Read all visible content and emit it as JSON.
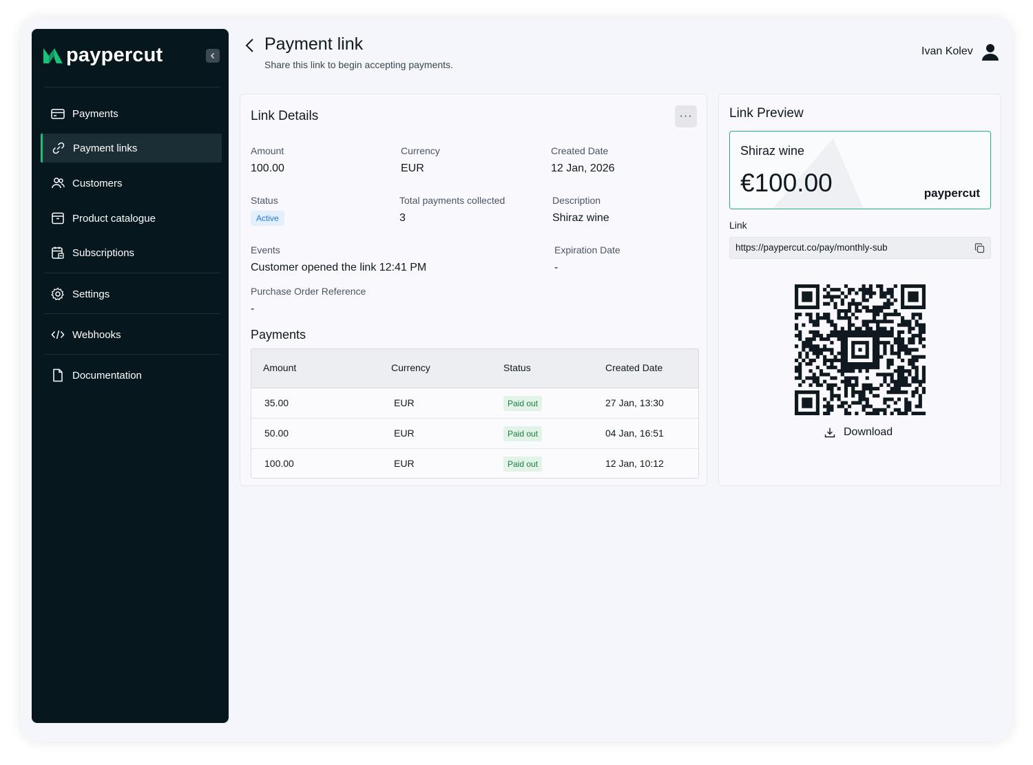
{
  "app": {
    "brand": "paypercut",
    "brand_color": "#17c27a"
  },
  "sidebar": {
    "items": [
      {
        "label": "Payments",
        "icon": "credit-card-icon"
      },
      {
        "label": "Payment links",
        "icon": "link-icon",
        "active": true
      },
      {
        "label": "Customers",
        "icon": "users-icon"
      },
      {
        "label": "Product catalogue",
        "icon": "archive-box-icon"
      },
      {
        "label": "Subscriptions",
        "icon": "calendar-icon"
      },
      {
        "label": "Settings",
        "icon": "gear-icon"
      },
      {
        "label": "Webhooks",
        "icon": "code-icon"
      },
      {
        "label": "Documentation",
        "icon": "document-icon"
      }
    ]
  },
  "header": {
    "title": "Payment link",
    "subtitle": "Share this link to begin accepting payments.",
    "user_name": "Ivan Kolev"
  },
  "details": {
    "title": "Link Details",
    "more_label": "···",
    "amount_label": "Amount",
    "amount_value": "100.00",
    "currency_label": "Currency",
    "currency_value": "EUR",
    "created_label": "Created Date",
    "created_value": "12 Jan, 2026",
    "status_label": "Status",
    "status_value": "Active",
    "total_label": "Total payments collected",
    "total_value": "3",
    "description_label": "Description",
    "description_value": "Shiraz wine",
    "events_label": "Events",
    "events_value": "Customer opened the link 12:41 PM",
    "expiration_label": "Expiration Date",
    "expiration_value": "-",
    "po_label": "Purchase Order Reference",
    "po_value": "-"
  },
  "payments": {
    "title": "Payments",
    "columns": [
      "Amount",
      "Currency",
      "Status",
      "Created Date"
    ],
    "rows": [
      {
        "amount": "35.00",
        "currency": "EUR",
        "status": "Paid out",
        "date": "27 Jan, 13:30"
      },
      {
        "amount": "50.00",
        "currency": "EUR",
        "status": "Paid out",
        "date": "04 Jan, 16:51"
      },
      {
        "amount": "100.00",
        "currency": "EUR",
        "status": "Paid out",
        "date": "12 Jan, 10:12"
      }
    ]
  },
  "preview": {
    "title": "Link Preview",
    "product": "Shiraz wine",
    "price": "€100.00",
    "brand": "paypercut",
    "link_label": "Link",
    "link_value": "https://paypercut.co/pay/monthly-sub",
    "download_label": "Download"
  }
}
